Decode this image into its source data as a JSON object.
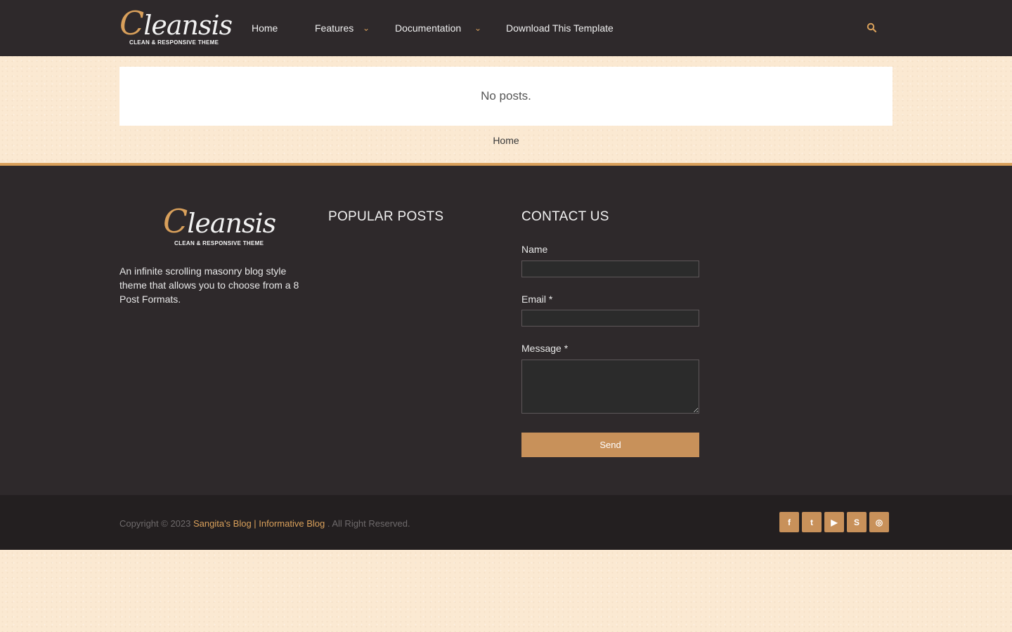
{
  "header": {
    "logo_text": "leansis",
    "logo_initial": "C",
    "logo_tagline": "CLEAN & RESPONSIVE THEME",
    "nav": [
      {
        "label": "Home"
      },
      {
        "label": "Features",
        "has_dropdown": true
      },
      {
        "label": "Documentation",
        "has_dropdown": true
      },
      {
        "label": "Download This Template"
      }
    ],
    "search_icon": "search-icon"
  },
  "main": {
    "no_posts_text": "No posts.",
    "breadcrumb_home": "Home"
  },
  "footer": {
    "about_text": "An infinite scrolling masonry blog style theme that allows you to choose from a 8 Post Formats.",
    "popular_posts_title": "POPULAR POSTS",
    "contact_title": "CONTACT US",
    "contact_form": {
      "name_label": "Name",
      "email_label": "Email *",
      "message_label": "Message *",
      "send_label": "Send"
    }
  },
  "bottom": {
    "copyright_prefix": "Copyright © 2023",
    "site_link": "Sangita's Blog | Informative Blog",
    "rights": ". All Right Reserved.",
    "social": [
      {
        "name": "facebook-icon",
        "glyph": "f"
      },
      {
        "name": "twitter-icon",
        "glyph": "t"
      },
      {
        "name": "youtube-icon",
        "glyph": "▶"
      },
      {
        "name": "skype-icon",
        "glyph": "S"
      },
      {
        "name": "instagram-icon",
        "glyph": "◎"
      }
    ]
  },
  "colors": {
    "accent": "#d9a05b",
    "header_bg": "#2e292b",
    "footer_bg": "#2e292b",
    "bottom_bg": "#231f20",
    "page_bg": "#fbe9d2"
  }
}
